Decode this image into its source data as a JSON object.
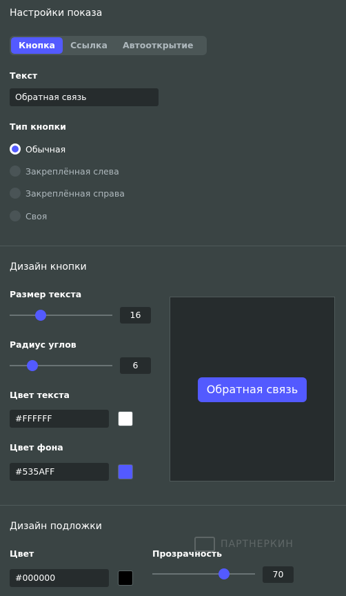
{
  "section_show": {
    "title": "Настройки показа",
    "tabs": [
      {
        "label": "Кнопка",
        "active": true
      },
      {
        "label": "Ссылка",
        "active": false
      },
      {
        "label": "Автооткрытие",
        "active": false
      }
    ],
    "text_label": "Текст",
    "text_value": "Обратная связь",
    "button_type_label": "Тип кнопки",
    "button_types": [
      {
        "label": "Обычная",
        "checked": true
      },
      {
        "label": "Закреплённая слева",
        "checked": false
      },
      {
        "label": "Закреплённая справа",
        "checked": false
      },
      {
        "label": "Своя",
        "checked": false
      }
    ]
  },
  "section_button_design": {
    "title": "Дизайн кнопки",
    "text_size_label": "Размер текста",
    "text_size_value": "16",
    "text_size_fraction": 0.3,
    "radius_label": "Радиус углов",
    "radius_value": "6",
    "radius_fraction": 0.22,
    "text_color_label": "Цвет текста",
    "text_color_value": "#FFFFFF",
    "bg_color_label": "Цвет фона",
    "bg_color_value": "#535AFF",
    "preview_button_label": "Обратная связь"
  },
  "section_backdrop": {
    "title": "Дизайн подложки",
    "color_label": "Цвет",
    "color_value": "#000000",
    "opacity_label": "Прозрачность",
    "opacity_value": "70",
    "opacity_fraction": 0.7
  },
  "watermark": "ПАРТНЕРКИН",
  "colors": {
    "accent": "#535aff",
    "background": "#3a4444",
    "field": "#262c2d"
  }
}
